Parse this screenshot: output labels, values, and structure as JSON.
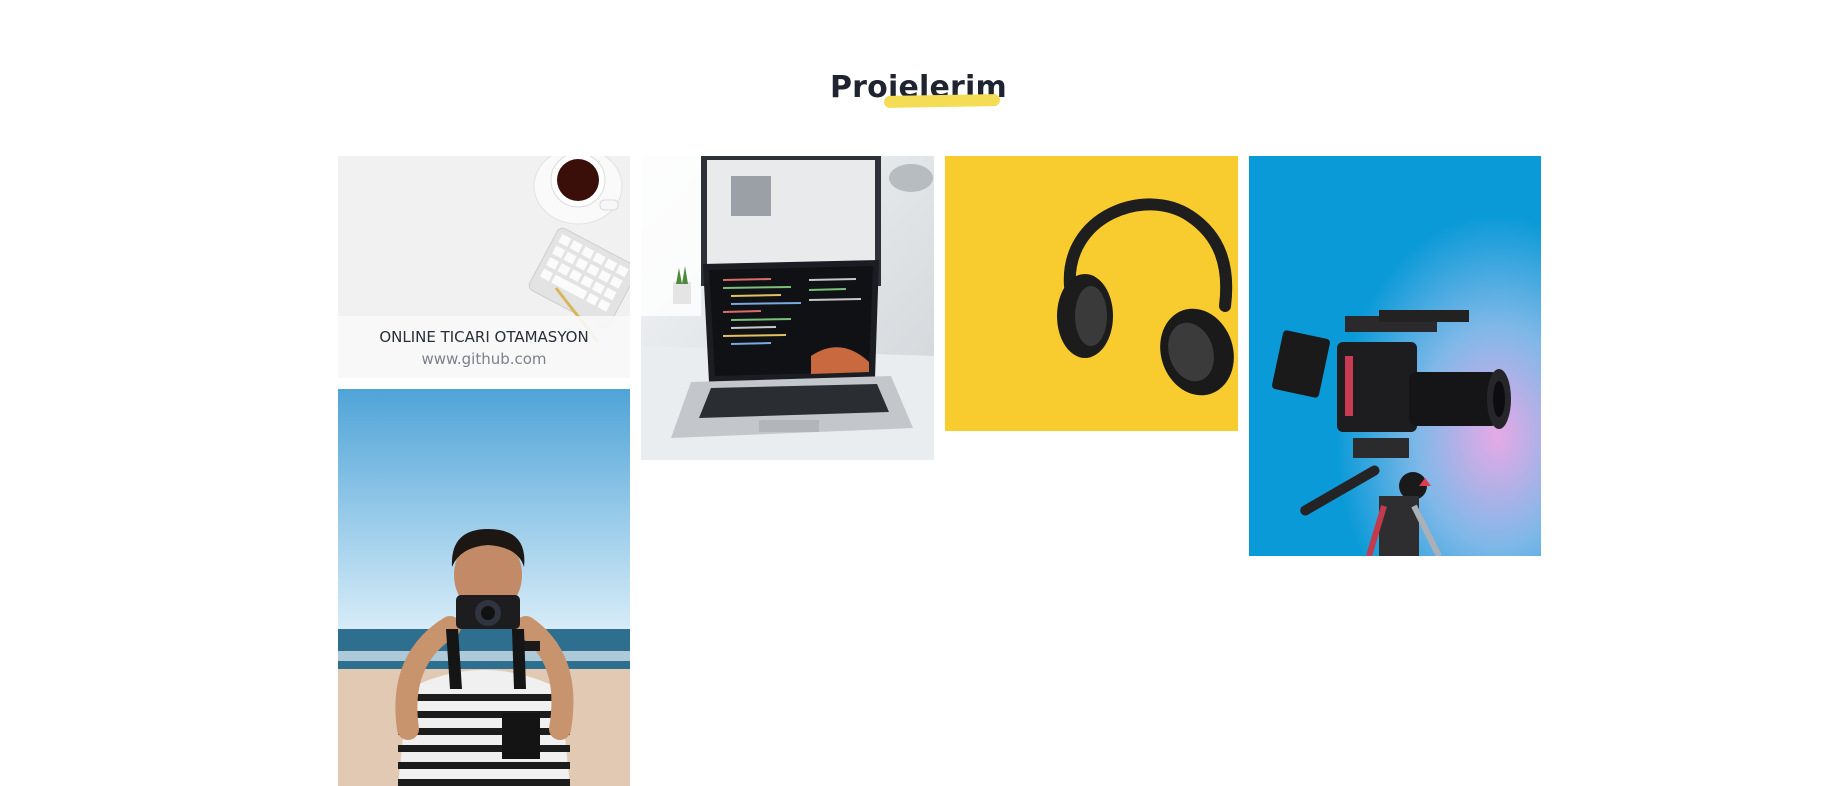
{
  "section": {
    "title": "Projelerim",
    "accent_color": "#f5dc55"
  },
  "projects": [
    {
      "image": "desk-coffee-keyboard-photo",
      "title": "ONLINE TICARI OTAMASYON",
      "link": "www.github.com"
    },
    {
      "image": "laptop-code-photo"
    },
    {
      "image": "yellow-headphones-photo"
    },
    {
      "image": "camera-tripod-blue-photo"
    },
    {
      "image": "photographer-beach-photo"
    }
  ]
}
